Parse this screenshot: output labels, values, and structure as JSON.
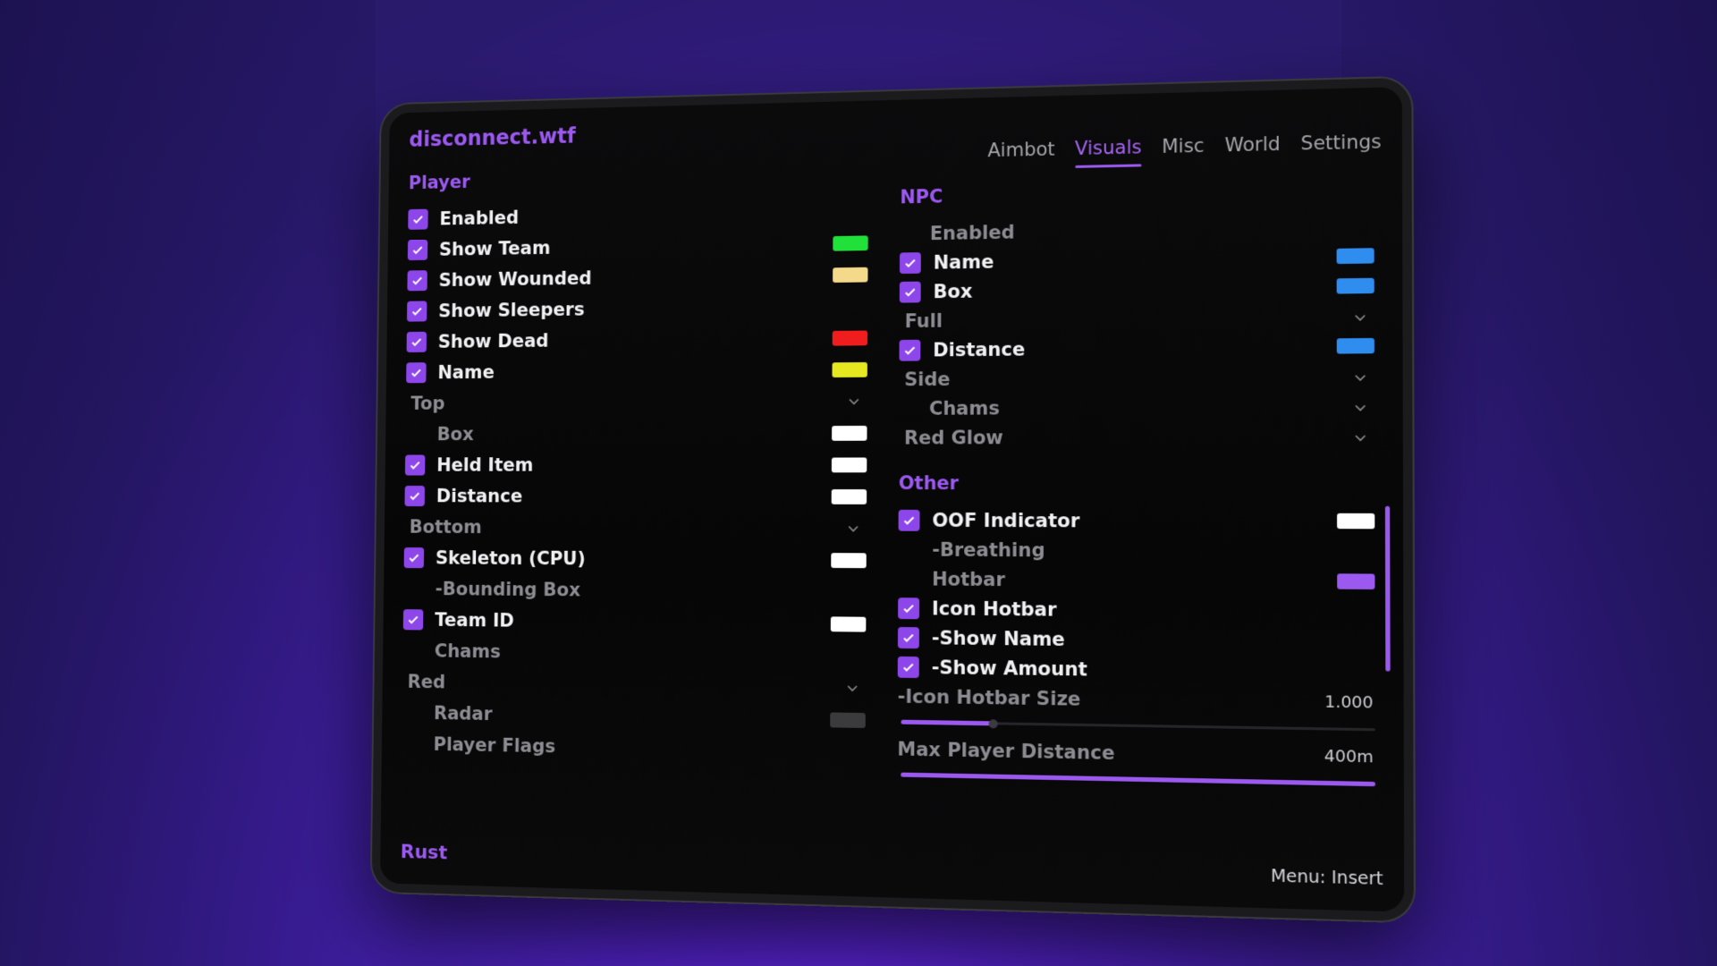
{
  "app": {
    "brand": "disconnect.wtf",
    "game": "Rust",
    "menu_hint": "Menu: Insert"
  },
  "tabs": [
    {
      "label": "Aimbot",
      "active": false
    },
    {
      "label": "Visuals",
      "active": true
    },
    {
      "label": "Misc",
      "active": false
    },
    {
      "label": "World",
      "active": false
    },
    {
      "label": "Settings",
      "active": false
    }
  ],
  "player": {
    "title": "Player",
    "enabled": "Enabled",
    "show_team": "Show Team",
    "show_wounded": "Show Wounded",
    "show_sleepers": "Show Sleepers",
    "show_dead": "Show Dead",
    "name": "Name",
    "name_position": "Top",
    "box": "Box",
    "held_item": "Held Item",
    "distance": "Distance",
    "distance_position": "Bottom",
    "skeleton": "Skeleton (CPU)",
    "bounding_box": "-Bounding Box",
    "team_id": "Team ID",
    "chams": "Chams",
    "chams_value": "Red",
    "radar": "Radar",
    "player_flags": "Player Flags"
  },
  "npc": {
    "title": "NPC",
    "enabled": "Enabled",
    "name": "Name",
    "box": "Box",
    "box_style": "Full",
    "distance": "Distance",
    "distance_position": "Side",
    "chams": "Chams",
    "chams_value": "Red Glow"
  },
  "other": {
    "title": "Other",
    "oof_indicator": "OOF Indicator",
    "breathing": "-Breathing",
    "hotbar": "Hotbar",
    "icon_hotbar": "Icon Hotbar",
    "show_name": "-Show Name",
    "show_amount": "-Show Amount",
    "icon_hotbar_size": "-Icon Hotbar Size",
    "icon_hotbar_size_value": "1.000",
    "icon_hotbar_size_fraction": 0.2,
    "max_player_distance": "Max Player Distance",
    "max_player_distance_value": "400m",
    "max_player_distance_fraction": 1.0
  },
  "colors": {
    "accent": "#9b59f0",
    "show_team": "#22e03a",
    "show_wounded": "#f5d98a",
    "show_dead": "#ef1d1d",
    "name": "#e6e91f",
    "white": "#ffffff",
    "radar": "#3b3b3e",
    "npc_blue": "#2f8df0",
    "hotbar": "#9b59f0"
  }
}
